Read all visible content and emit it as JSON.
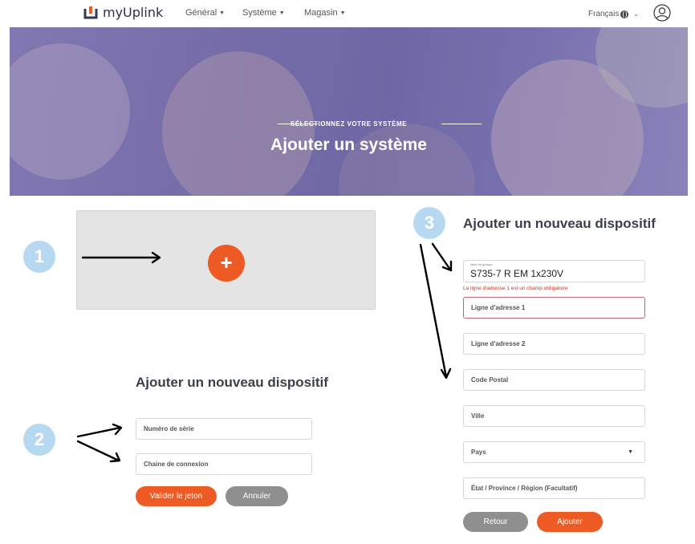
{
  "nav": {
    "logo_text": "myUplink",
    "items": [
      "Général",
      "Système",
      "Magasin"
    ],
    "language": "Français"
  },
  "hero": {
    "subtitle": "SÉLECTIONNEZ VOTRE SYSTÈME",
    "title": "Ajouter un système"
  },
  "badges": [
    "1",
    "2",
    "3"
  ],
  "add_box": {
    "plus_label": "+"
  },
  "left_form": {
    "title": "Ajouter un nouveau dispositif",
    "serial_placeholder": "Numéro de série",
    "connection_placeholder": "Chaine de connexion",
    "validate_label": "Valider le jeton",
    "cancel_label": "Annuler"
  },
  "right_form": {
    "title": "Ajouter un nouveau dispositif",
    "group_label": "Nom du groupe",
    "group_value": "S735-7 R EM 1x230V",
    "error": "La ligne d'adresse 1 est un champ obligatoire",
    "address1": "Ligne d'adresse 1",
    "address2": "Ligne d'adresse 2",
    "postal": "Code Postal",
    "city": "Ville",
    "country": "Pays",
    "state": "État / Province / Région (Facultatif)",
    "back_label": "Retour",
    "add_label": "Ajouter"
  },
  "colors": {
    "accent": "#ee5a24",
    "badge": "#b7d8f1",
    "secondary_button": "#8f8f8f",
    "hero_tint": "#7b72a8"
  }
}
